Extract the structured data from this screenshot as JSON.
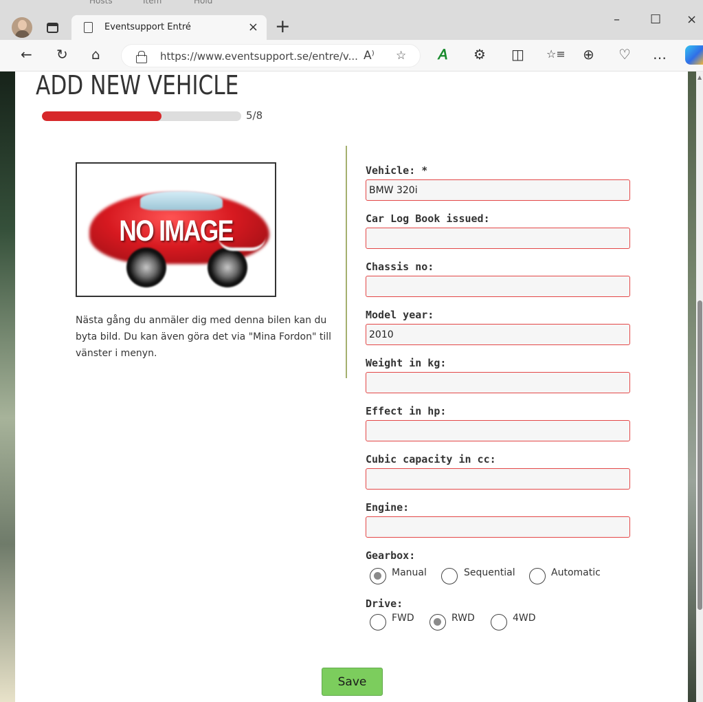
{
  "browser": {
    "ghost_tabs": [
      "Hosts",
      "Item",
      "Hold"
    ],
    "tab_title": "Eventsupport Entré",
    "tab_close": "×",
    "new_tab": "+",
    "window_controls": {
      "minimize": "–",
      "maximize": "☐",
      "close": "×"
    },
    "nav": {
      "back": "←",
      "refresh": "↻",
      "home": "⌂"
    },
    "url": "https://www.eventsupport.se/entre/v...",
    "address_icons": {
      "read_aloud": "A⁾",
      "favorite": "☆"
    },
    "toolbar_icons": [
      "𝘈",
      "⚙",
      "◫",
      "☆≡",
      "⊕",
      "♡",
      "…"
    ]
  },
  "page": {
    "heading": "ADD NEW VEHICLE",
    "progress": {
      "fraction": 0.6,
      "label": "5/8"
    },
    "image_placeholder": {
      "text": "NO IMAGE"
    },
    "note": "Nästa gång du anmäler dig med denna bilen kan du byta bild. Du kan även göra det via \"Mina Fordon\" till vänster i menyn."
  },
  "form": {
    "fields": [
      {
        "label": "Vehicle: *",
        "value": "BMW 320i"
      },
      {
        "label": "Car Log Book issued:",
        "value": ""
      },
      {
        "label": "Chassis no:",
        "value": ""
      },
      {
        "label": "Model year:",
        "value": "2010"
      },
      {
        "label": "Weight in kg:",
        "value": ""
      },
      {
        "label": "Effect in hp:",
        "value": ""
      },
      {
        "label": "Cubic capacity in cc:",
        "value": ""
      },
      {
        "label": "Engine:",
        "value": ""
      }
    ],
    "gearbox": {
      "label": "Gearbox:",
      "options": [
        "Manual",
        "Sequential",
        "Automatic"
      ],
      "selected": "Manual"
    },
    "drive": {
      "label": "Drive:",
      "options": [
        "FWD",
        "RWD",
        "4WD"
      ],
      "selected": "RWD"
    },
    "save_label": "Save"
  },
  "colors": {
    "progress_fill": "#d7282a",
    "input_border": "#e34646",
    "save_button": "#7ccd5d",
    "divider": "#a4b06e"
  }
}
